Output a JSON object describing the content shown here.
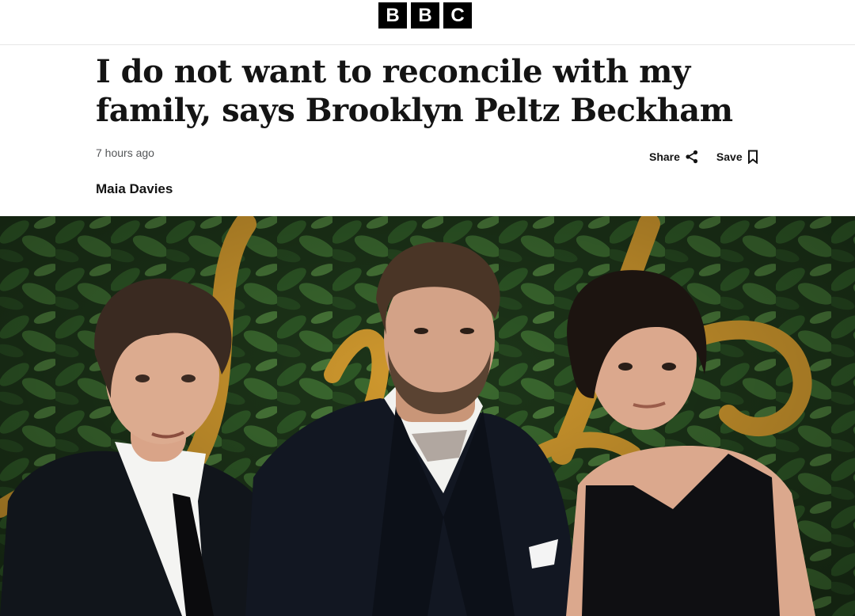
{
  "brand": {
    "letters": [
      "B",
      "B",
      "C"
    ]
  },
  "article": {
    "headline": "I do not want to reconcile with my family, says Brooklyn Peltz Beckham",
    "timestamp": "7 hours ago",
    "author": "Maia Davies",
    "actions": {
      "share_label": "Share",
      "save_label": "Save"
    }
  },
  "hero_image": {
    "subject": "Three people in formal black attire in front of a green leaf wall with a gold glitter script sign",
    "colors": {
      "foliage": "#24401f",
      "gold": "#d29a2e",
      "suit": "#12161d",
      "skin": "#d9a488"
    }
  }
}
